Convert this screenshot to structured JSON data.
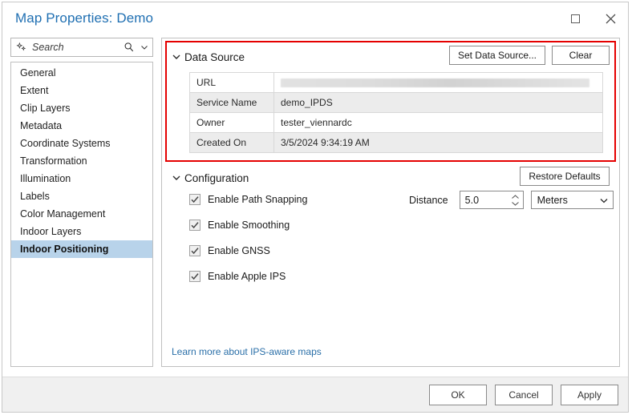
{
  "window": {
    "title": "Map Properties: Demo",
    "controls": {
      "maximize": "maximize-icon",
      "close": "close-icon"
    }
  },
  "search": {
    "placeholder": "Search",
    "sparkle_icon": "sparkle-icon",
    "magnifier_icon": "search-icon",
    "chevron_icon": "chevron-down-icon"
  },
  "sidebar": {
    "items": [
      {
        "label": "General",
        "selected": false
      },
      {
        "label": "Extent",
        "selected": false
      },
      {
        "label": "Clip Layers",
        "selected": false
      },
      {
        "label": "Metadata",
        "selected": false
      },
      {
        "label": "Coordinate Systems",
        "selected": false
      },
      {
        "label": "Transformation",
        "selected": false
      },
      {
        "label": "Illumination",
        "selected": false
      },
      {
        "label": "Labels",
        "selected": false
      },
      {
        "label": "Color Management",
        "selected": false
      },
      {
        "label": "Indoor Layers",
        "selected": false
      },
      {
        "label": "Indoor Positioning",
        "selected": true
      }
    ]
  },
  "data_source": {
    "title": "Data Source",
    "set_button": "Set Data Source...",
    "clear_button": "Clear",
    "rows": [
      {
        "key": "URL",
        "value": "",
        "redacted": true
      },
      {
        "key": "Service Name",
        "value": "demo_IPDS",
        "redacted": false
      },
      {
        "key": "Owner",
        "value": "tester_viennardc",
        "redacted": false
      },
      {
        "key": "Created On",
        "value": "3/5/2024 9:34:19 AM",
        "redacted": false
      }
    ]
  },
  "configuration": {
    "title": "Configuration",
    "restore_button": "Restore Defaults",
    "checkboxes": [
      {
        "label": "Enable Path Snapping",
        "checked": true
      },
      {
        "label": "Enable Smoothing",
        "checked": true
      },
      {
        "label": "Enable GNSS",
        "checked": true
      },
      {
        "label": "Enable Apple IPS",
        "checked": true
      }
    ],
    "distance": {
      "label": "Distance",
      "value": "5.0",
      "unit": "Meters",
      "unit_options": [
        "Meters"
      ]
    }
  },
  "link": {
    "text": "Learn more about IPS-aware maps"
  },
  "footer": {
    "ok": "OK",
    "cancel": "Cancel",
    "apply": "Apply"
  },
  "colors": {
    "title_blue": "#1f6fb2",
    "selection_blue": "#b8d3ea",
    "highlight_red": "#e50000",
    "link_blue": "#2a6fa8"
  }
}
